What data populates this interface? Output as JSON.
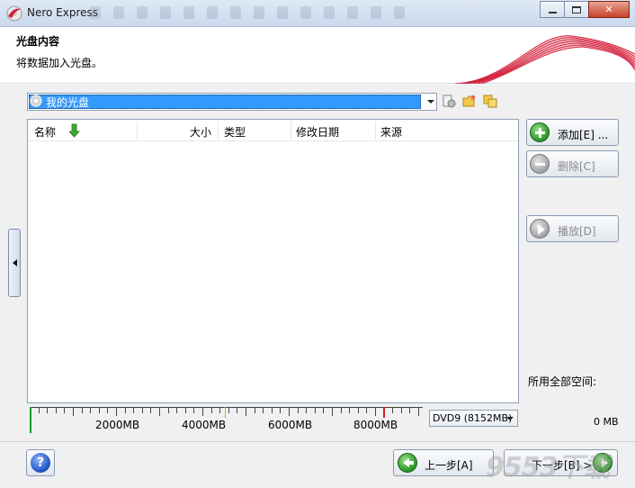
{
  "window": {
    "title": "Nero Express",
    "close_symbol": "✕"
  },
  "header": {
    "title": "光盘内容",
    "subtitle": "将数据加入光盘。"
  },
  "disc": {
    "name": "我的光盘"
  },
  "list": {
    "columns": [
      "名称",
      "大小",
      "类型",
      "修改日期",
      "来源"
    ]
  },
  "capacity": {
    "labels": [
      "2000MB",
      "4000MB",
      "6000MB",
      "8000MB"
    ],
    "disc_type": "DVD9 (8152MB)",
    "used_fraction": 0
  },
  "buttons": {
    "add": "添加[E] ...",
    "delete": "删除[C]",
    "play": "播放[D]",
    "back": "上一步[A]",
    "next": "下一步[B] >",
    "help": "?"
  },
  "space": {
    "label": "所用全部空间:",
    "value": "0 MB"
  },
  "watermark": "9553下载",
  "colors": {
    "selection": "#3399ff",
    "brand_red": "#d41f3a"
  }
}
